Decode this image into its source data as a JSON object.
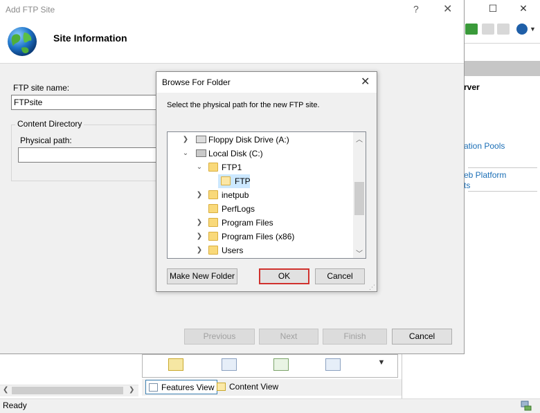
{
  "wizard": {
    "title": "Add FTP Site",
    "help_glyph": "?",
    "close_glyph": "✕",
    "heading": "Site Information",
    "ftp_site_name_label": "FTP site name:",
    "ftp_site_name_value": "FTPsite",
    "content_directory_label": "Content Directory",
    "physical_path_label": "Physical path:",
    "physical_path_value": "",
    "buttons": {
      "previous": "Previous",
      "next": "Next",
      "finish": "Finish",
      "cancel": "Cancel"
    }
  },
  "browse_dialog": {
    "title": "Browse For Folder",
    "close_glyph": "✕",
    "description": "Select the physical path for the new FTP site.",
    "tree": [
      {
        "label": "Floppy Disk Drive (A:)",
        "icon": "floppy-drive-icon",
        "expanded": false,
        "selected": false
      },
      {
        "label": "Local Disk (C:)",
        "icon": "hard-drive-icon",
        "expanded": true,
        "selected": false
      },
      {
        "label": "FTP1",
        "icon": "folder-icon",
        "expanded": true,
        "selected": false
      },
      {
        "label": "FTP",
        "icon": "folder-open-icon",
        "expanded": false,
        "selected": true
      },
      {
        "label": "inetpub",
        "icon": "folder-icon",
        "expanded": false,
        "selected": false
      },
      {
        "label": "PerfLogs",
        "icon": "folder-icon",
        "expanded": false,
        "selected": false
      },
      {
        "label": "Program Files",
        "icon": "folder-icon",
        "expanded": false,
        "selected": false
      },
      {
        "label": "Program Files (x86)",
        "icon": "folder-icon",
        "expanded": false,
        "selected": false
      },
      {
        "label": "Users",
        "icon": "folder-icon",
        "expanded": false,
        "selected": false
      }
    ],
    "buttons": {
      "make_new_folder": "Make New Folder",
      "ok": "OK",
      "cancel": "Cancel"
    },
    "highlight_color": "#d0312d"
  },
  "iis": {
    "actions": {
      "server_heading_fragment": "rver",
      "link_app_pools_fragment": "ation Pools",
      "link_web_platform_fragment_1": "eb Platform",
      "link_web_platform_fragment_2": "ts"
    },
    "view_tabs": {
      "features_view": "Features View",
      "content_view": "Content View"
    },
    "status": "Ready",
    "link_color": "#1a6eb6"
  }
}
